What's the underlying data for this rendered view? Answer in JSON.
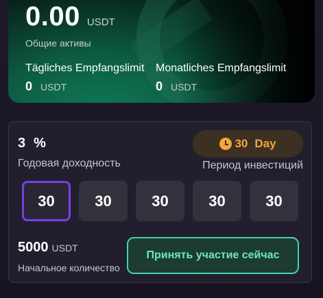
{
  "assets": {
    "total_value": "0.00",
    "total_unit": "USDT",
    "total_label": "Общие активы",
    "daily_limit_label": "Tägliches Empfangslimit",
    "daily_limit_value": "0",
    "daily_limit_unit": "USDT",
    "monthly_limit_label": "Monatliches Empfangslimit",
    "monthly_limit_value": "0",
    "monthly_limit_unit": "USDT"
  },
  "investment": {
    "rate_value": "3",
    "rate_unit": "%",
    "rate_label": "Годовая доходность",
    "period_value": "30",
    "period_unit": "Day",
    "period_label": "Период инвестиций",
    "options": [
      "30",
      "30",
      "30",
      "30",
      "30"
    ],
    "selected_option_index": 0,
    "amount_value": "5000",
    "amount_unit": "USDT",
    "amount_label": "Начальное количество",
    "join_button_label": "Принять участие сейчас"
  },
  "colors": {
    "accent_green": "#43d6a2",
    "accent_orange": "#f1a73a",
    "accent_purple": "#7b3fe4"
  },
  "icons": {
    "period": "clock-icon"
  }
}
